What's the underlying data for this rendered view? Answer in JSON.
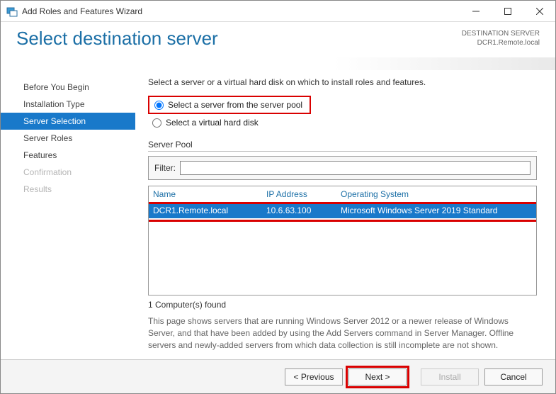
{
  "window": {
    "title": "Add Roles and Features Wizard"
  },
  "header": {
    "title": "Select destination server",
    "dest_label": "DESTINATION SERVER",
    "dest_value": "DCR1.Remote.local"
  },
  "steps": {
    "before": "Before You Begin",
    "install_type": "Installation Type",
    "server_selection": "Server Selection",
    "server_roles": "Server Roles",
    "features": "Features",
    "confirmation": "Confirmation",
    "results": "Results"
  },
  "main": {
    "instruction": "Select a server or a virtual hard disk on which to install roles and features.",
    "radio_pool": "Select a server from the server pool",
    "radio_vhd": "Select a virtual hard disk",
    "pool_label": "Server Pool",
    "filter_label": "Filter:",
    "filter_value": "",
    "columns": {
      "name": "Name",
      "ip": "IP Address",
      "os": "Operating System"
    },
    "rows": [
      {
        "name": "DCR1.Remote.local",
        "ip": "10.6.63.100",
        "os": "Microsoft Windows Server 2019 Standard"
      }
    ],
    "count": "1 Computer(s) found",
    "note": "This page shows servers that are running Windows Server 2012 or a newer release of Windows Server, and that have been added by using the Add Servers command in Server Manager. Offline servers and newly-added servers from which data collection is still incomplete are not shown."
  },
  "footer": {
    "previous": "< Previous",
    "next": "Next >",
    "install": "Install",
    "cancel": "Cancel"
  }
}
